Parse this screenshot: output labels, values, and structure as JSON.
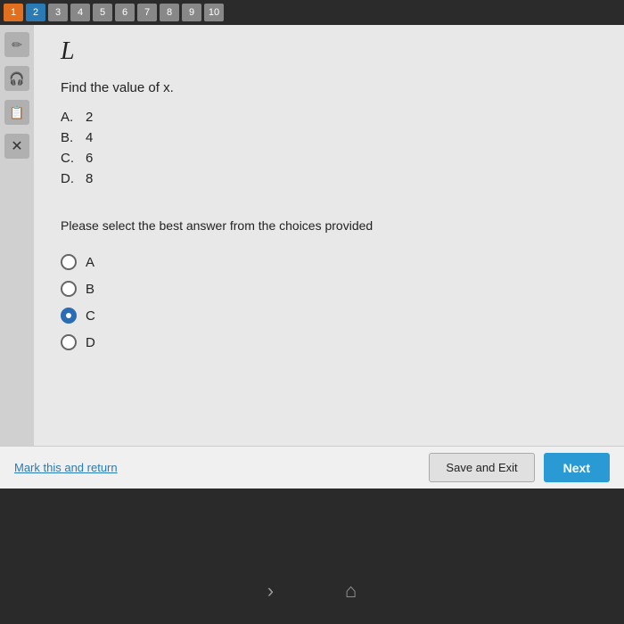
{
  "topbar": {
    "questions": [
      {
        "num": "1",
        "state": "orange"
      },
      {
        "num": "2",
        "state": "blue"
      },
      {
        "num": "3",
        "state": "default"
      },
      {
        "num": "4",
        "state": "default"
      },
      {
        "num": "5",
        "state": "default"
      },
      {
        "num": "6",
        "state": "default"
      },
      {
        "num": "7",
        "state": "default"
      },
      {
        "num": "8",
        "state": "default"
      },
      {
        "num": "9",
        "state": "default"
      },
      {
        "num": "10",
        "state": "default"
      }
    ]
  },
  "sidebar": {
    "icons": [
      "✏️",
      "🎧",
      "📋",
      "×"
    ]
  },
  "question": {
    "header": "L",
    "text": "Find the value of x.",
    "choices": [
      {
        "label": "A.",
        "value": "2"
      },
      {
        "label": "B.",
        "value": "4"
      },
      {
        "label": "C.",
        "value": "6"
      },
      {
        "label": "D.",
        "value": "8"
      }
    ],
    "instruction": "Please select the best answer from the choices provided",
    "radio_options": [
      {
        "label": "A",
        "selected": false
      },
      {
        "label": "B",
        "selected": false
      },
      {
        "label": "C",
        "selected": true
      },
      {
        "label": "D",
        "selected": false
      }
    ]
  },
  "bottombar": {
    "mark_return_label": "Mark this and return",
    "save_exit_label": "Save and Exit",
    "next_label": "Next"
  },
  "nav": {
    "chevron": "›",
    "home": "⌂"
  }
}
